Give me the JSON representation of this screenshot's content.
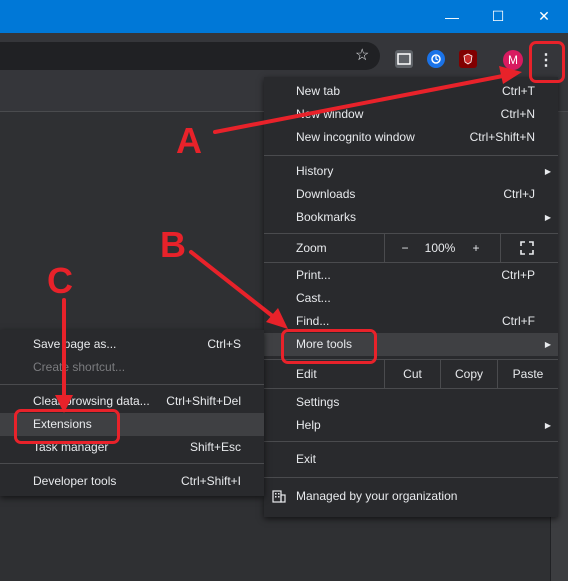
{
  "window": {
    "minimize": "—",
    "maximize": "☐",
    "close": "✕"
  },
  "toolbar": {
    "bookmark_star": "☆",
    "profile_initial": "M",
    "menu_glyph": "⋮"
  },
  "menu": {
    "items": [
      {
        "label": "New tab",
        "shortcut": "Ctrl+T"
      },
      {
        "label": "New window",
        "shortcut": "Ctrl+N"
      },
      {
        "label": "New incognito window",
        "shortcut": "Ctrl+Shift+N"
      },
      {
        "label": "History",
        "shortcut": ""
      },
      {
        "label": "Downloads",
        "shortcut": "Ctrl+J"
      },
      {
        "label": "Bookmarks",
        "shortcut": ""
      },
      {
        "label": "Zoom",
        "shortcut": ""
      },
      {
        "label": "Print...",
        "shortcut": "Ctrl+P"
      },
      {
        "label": "Cast...",
        "shortcut": ""
      },
      {
        "label": "Find...",
        "shortcut": "Ctrl+F"
      },
      {
        "label": "More tools",
        "shortcut": ""
      },
      {
        "label": "Edit",
        "shortcut": ""
      },
      {
        "label": "Settings",
        "shortcut": ""
      },
      {
        "label": "Help",
        "shortcut": ""
      },
      {
        "label": "Exit",
        "shortcut": ""
      },
      {
        "label": "Managed by your organization",
        "shortcut": ""
      }
    ],
    "zoom": {
      "minus": "−",
      "value": "100%",
      "plus": "+"
    },
    "edit": {
      "cut": "Cut",
      "copy": "Copy",
      "paste": "Paste"
    }
  },
  "submenu": {
    "items": [
      {
        "label": "Save page as...",
        "shortcut": "Ctrl+S"
      },
      {
        "label": "Create shortcut...",
        "shortcut": ""
      },
      {
        "label": "Clear browsing data...",
        "shortcut": "Ctrl+Shift+Del"
      },
      {
        "label": "Extensions",
        "shortcut": ""
      },
      {
        "label": "Task manager",
        "shortcut": "Shift+Esc"
      },
      {
        "label": "Developer tools",
        "shortcut": "Ctrl+Shift+I"
      }
    ]
  },
  "annotations": {
    "a": "A",
    "b": "B",
    "c": "C"
  },
  "colors": {
    "annotation": "#e8222a",
    "titlebar": "#0078d7",
    "menu_bg": "#292a2d",
    "highlight": "#3f4043"
  }
}
